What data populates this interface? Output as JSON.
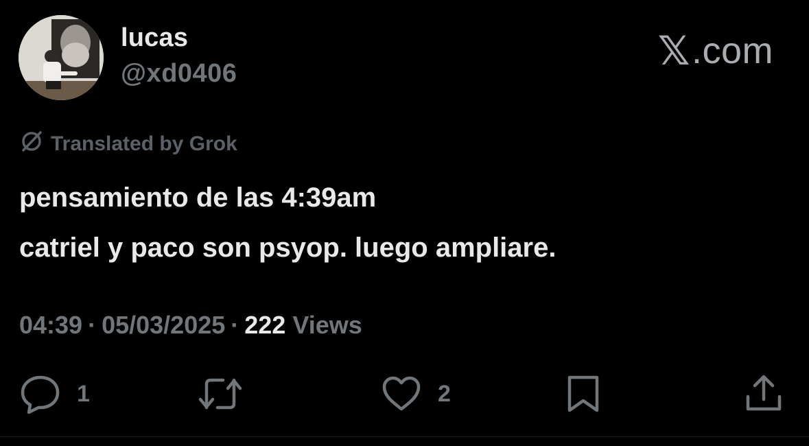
{
  "author": {
    "display_name": "lucas",
    "handle": "@xd0406"
  },
  "brand": {
    "x_glyph": "𝕏",
    "suffix": ".com"
  },
  "translation": {
    "label": "Translated by Grok",
    "icon": "grok-icon"
  },
  "tweet": {
    "lines": [
      "pensamiento de las 4:39am",
      "catriel y paco son psyop. luego ampliare."
    ]
  },
  "meta": {
    "time": "04:39",
    "separator": "·",
    "date": "05/03/2025",
    "views_count": "222",
    "views_label": "Views"
  },
  "actions": {
    "reply": {
      "icon": "reply-icon",
      "count": "1"
    },
    "repost": {
      "icon": "repost-icon",
      "count": ""
    },
    "like": {
      "icon": "heart-icon",
      "count": "2"
    },
    "bookmark": {
      "icon": "bookmark-icon"
    },
    "share": {
      "icon": "share-icon"
    }
  },
  "colors": {
    "background": "#000000",
    "primary_text": "#e7e9ea",
    "secondary_text": "#71767b"
  }
}
